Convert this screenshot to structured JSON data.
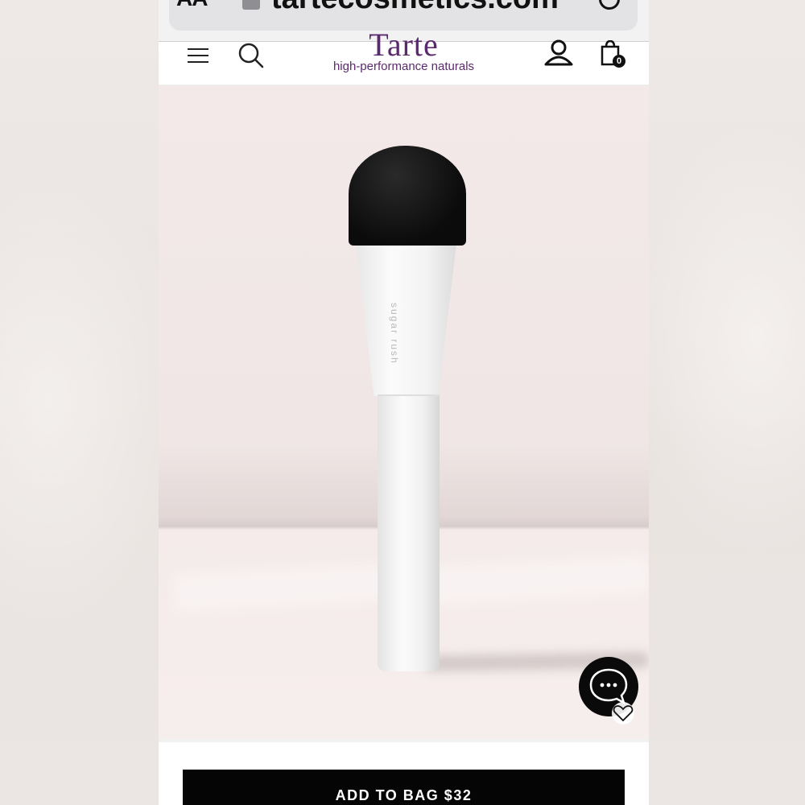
{
  "browser": {
    "text_size_label": "AA",
    "url": "tartecosmetics.com",
    "lock_icon": "lock-icon",
    "reload_icon": "reload-icon"
  },
  "header": {
    "logo_word": "Tarte",
    "tagline": "high-performance naturals",
    "menu_icon": "menu-icon",
    "search_icon": "search-icon",
    "account_icon": "account-icon",
    "bag_icon": "bag-icon",
    "bag_count": "0"
  },
  "product": {
    "image_label": "foundation brush",
    "brush_brand_text": "sugar rush",
    "chat_icon": "chat-bubble-icon",
    "wishlist_icon": "heart-icon"
  },
  "cta": {
    "add_to_bag_label": "ADD TO BAG $32"
  },
  "colors": {
    "brand_purple": "#5b2a6e",
    "cta_black": "#050505",
    "backdrop_pink": "#f2e9e8"
  }
}
